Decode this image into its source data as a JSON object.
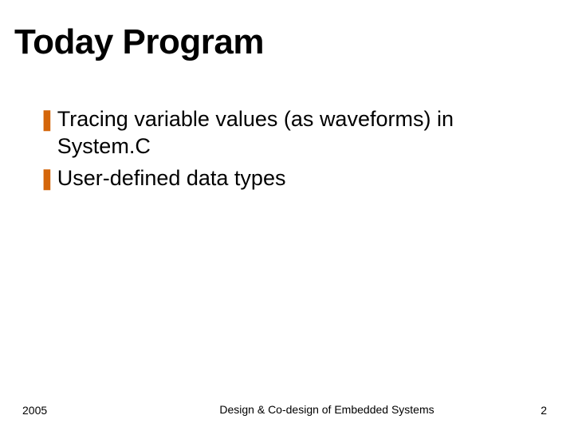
{
  "slide": {
    "title": "Today Program",
    "bullets": [
      {
        "marker": "❚",
        "text": "Tracing variable values (as waveforms) in System.C"
      },
      {
        "marker": "❚",
        "text": "User-defined data types"
      }
    ],
    "footer": {
      "left": "2005",
      "center": "Design & Co-design of Embedded Systems",
      "right": "2"
    }
  },
  "colors": {
    "accent_brush": "#f4d24a",
    "bullet_marker": "#d4660a"
  }
}
